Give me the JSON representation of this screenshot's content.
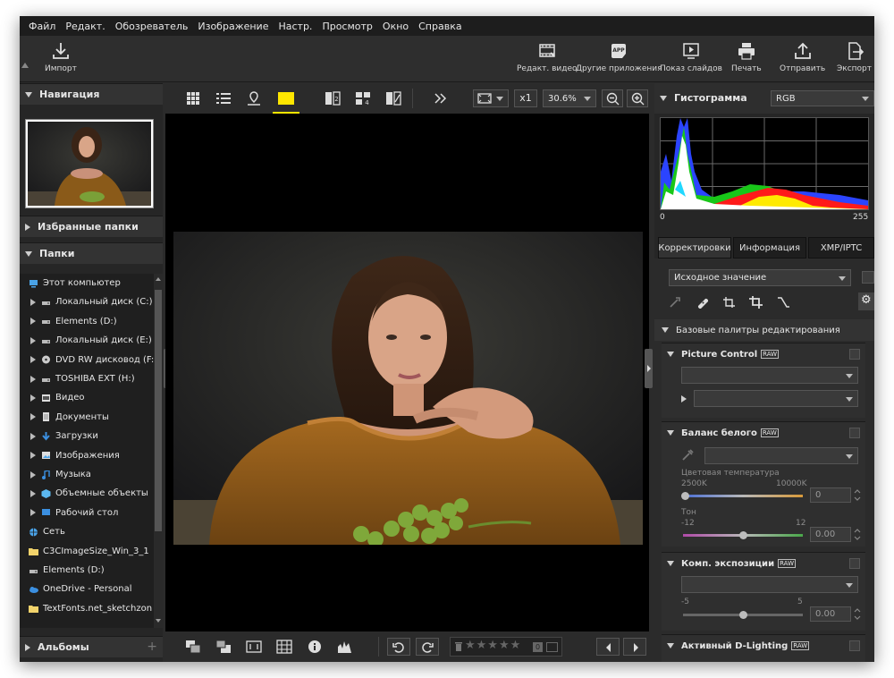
{
  "menu": [
    "Файл",
    "Редакт.",
    "Обозреватель",
    "Изображение",
    "Настр.",
    "Просмотр",
    "Окно",
    "Справка"
  ],
  "toolbar": {
    "import": "Импорт",
    "edit_video": "Редакт. видео",
    "other_apps": "Другие приложения",
    "app_badge": "APP",
    "slideshow": "Показ слайдов",
    "print": "Печать",
    "send": "Отправить",
    "export": "Экспорт"
  },
  "left": {
    "navigation": "Навигация",
    "favorites": "Избранные папки",
    "folders": "Папки",
    "albums": "Альбомы",
    "tree": [
      {
        "label": "Этот компьютер",
        "indent": 0,
        "icon": "computer-icon"
      },
      {
        "label": "Локальный диск (C:)",
        "indent": 1,
        "icon": "drive-icon"
      },
      {
        "label": "Elements (D:)",
        "indent": 1,
        "icon": "drive-icon"
      },
      {
        "label": "Локальный диск (E:)",
        "indent": 1,
        "icon": "drive-icon"
      },
      {
        "label": "DVD RW дисковод (F:)",
        "indent": 1,
        "icon": "dvd-icon"
      },
      {
        "label": "TOSHIBA EXT (H:)",
        "indent": 1,
        "icon": "drive-icon"
      },
      {
        "label": "Видео",
        "indent": 1,
        "icon": "video-folder-icon"
      },
      {
        "label": "Документы",
        "indent": 1,
        "icon": "documents-icon"
      },
      {
        "label": "Загрузки",
        "indent": 1,
        "icon": "downloads-icon"
      },
      {
        "label": "Изображения",
        "indent": 1,
        "icon": "pictures-icon"
      },
      {
        "label": "Музыка",
        "indent": 1,
        "icon": "music-icon"
      },
      {
        "label": "Объемные объекты",
        "indent": 1,
        "icon": "3d-objects-icon"
      },
      {
        "label": "Рабочий стол",
        "indent": 1,
        "icon": "desktop-icon"
      },
      {
        "label": "Сеть",
        "indent": 0,
        "icon": "network-icon"
      },
      {
        "label": "C3CImageSize_Win_3_1",
        "indent": 0,
        "icon": "folder-icon"
      },
      {
        "label": "Elements (D:)",
        "indent": 0,
        "icon": "drive-icon"
      },
      {
        "label": "OneDrive - Personal",
        "indent": 0,
        "icon": "onedrive-icon"
      },
      {
        "label": "TextFonts.net_sketchzon",
        "indent": 0,
        "icon": "folder-icon"
      }
    ]
  },
  "view": {
    "zoom_mode": "x1",
    "zoom_level": "30.6%"
  },
  "right": {
    "histogram": "Гистограмма",
    "channel": "RGB",
    "axis_min": "0",
    "axis_max": "255",
    "tabs": [
      "Корректировки",
      "Информация",
      "XMP/IPTC"
    ],
    "preset": "Исходное значение",
    "basic_palettes": "Базовые палитры редактирования",
    "picture_control": "Picture Control",
    "raw": "RAW",
    "white_balance": "Баланс белого",
    "color_temp": "Цветовая температура",
    "temp_min": "2500K",
    "temp_max": "10000K",
    "temp_value": "0",
    "tone": "Тон",
    "tone_min": "-12",
    "tone_max": "12",
    "tone_value": "0.00",
    "exposure": "Комп. экспозиции",
    "exp_min": "-5",
    "exp_max": "5",
    "exp_value": "0.00",
    "d_lighting": "Активный D-Lighting"
  },
  "colors": {
    "accent": "#ffe600",
    "background": "#2b2b2b"
  }
}
